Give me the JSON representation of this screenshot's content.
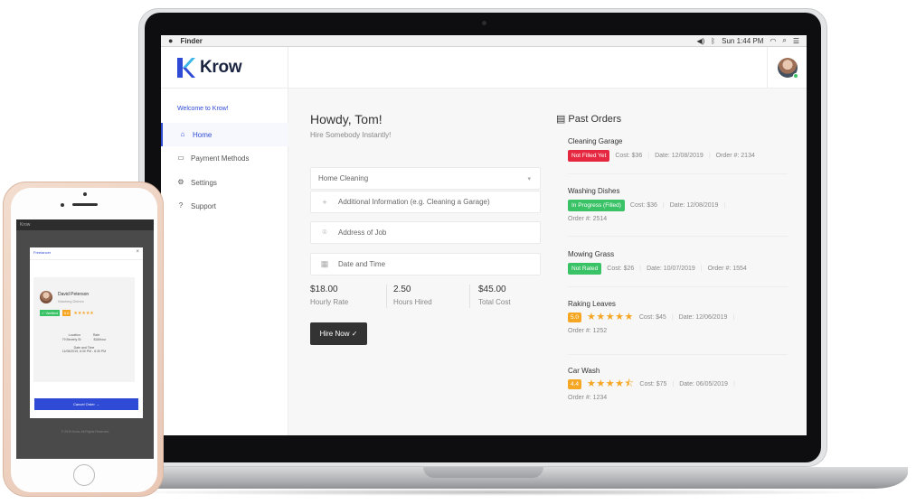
{
  "menubar": {
    "apple": "",
    "app": "Finder",
    "clock": "Sun 1:44 PM",
    "icons": [
      "volume-icon",
      "bluetooth-icon",
      "wifi-icon",
      "search-icon",
      "menu-icon"
    ]
  },
  "header": {
    "brand": "Krow",
    "brand_color": "#2f4bd6"
  },
  "sidebar": {
    "welcome": "Welcome to Krow!",
    "items": [
      {
        "label": "Home",
        "icon": "home-icon",
        "active": true
      },
      {
        "label": "Payment Methods",
        "icon": "credit-card-icon",
        "active": false
      },
      {
        "label": "Settings",
        "icon": "gear-icon",
        "active": false
      },
      {
        "label": "Support",
        "icon": "help-icon",
        "active": false
      }
    ]
  },
  "main": {
    "greeting": "Howdy, Tom!",
    "subtitle": "Hire Somebody Instantly!",
    "service_select": {
      "value": "Home Cleaning",
      "icon": "chevron-down-icon"
    },
    "fields": [
      {
        "placeholder": "Additional Information (e.g. Cleaning a Garage)",
        "icon": "plus-icon"
      },
      {
        "placeholder": "Address of Job",
        "icon": "map-pin-icon"
      },
      {
        "placeholder": "Date and Time",
        "icon": "calendar-icon"
      }
    ],
    "stats": [
      {
        "value": "$18.00",
        "label": "Hourly Rate"
      },
      {
        "value": "2.50",
        "label": "Hours Hired"
      },
      {
        "value": "$45.00",
        "label": "Total Cost"
      }
    ],
    "hire_button": "Hire Now ✓"
  },
  "past_orders": {
    "title": "Past Orders",
    "icon": "clipboard-icon",
    "orders": [
      {
        "name": "Cleaning Garage",
        "badge": "Not Filled Yet",
        "badge_color": "#e5283f",
        "cost": "Cost: $36",
        "date": "Date: 12/08/2019",
        "order": "Order #: 2134"
      },
      {
        "name": "Washing Dishes",
        "badge": "In Progress (Filled)",
        "badge_color": "#3ac266",
        "cost": "Cost: $36",
        "date": "Date: 12/08/2019",
        "order": "Order #: 2514"
      },
      {
        "name": "Mowing Grass",
        "badge": "Not Rated",
        "badge_color": "#3ac266",
        "cost": "Cost: $26",
        "date": "Date: 10/07/2019",
        "order": "Order #: 1554"
      },
      {
        "name": "Raking Leaves",
        "rating": "5.0",
        "stars": "★★★★★",
        "cost": "Cost: $45",
        "date": "Date: 12/06/2019",
        "order": "Order #: 1252"
      },
      {
        "name": "Car Wash",
        "rating": "4.4",
        "stars": "★★★★⯪",
        "cost": "Cost: $75",
        "date": "Date: 06/05/2019",
        "order": "Order #: 1234"
      }
    ]
  },
  "phone": {
    "bar_brand": "Krow",
    "tab": "Freelancer",
    "close": "×",
    "name": "David Peterson",
    "job": "Washing Dishes",
    "verified": "✓ Verified",
    "rating": "5.0",
    "stars": "★★★★★",
    "location_label": "Location",
    "location": "79 Beverly St",
    "rate_label": "Rate",
    "rate": "$18/hour",
    "datetime_label": "Date and Time",
    "datetime": "11/08/2019, 6:30 PM - 8:30 PM",
    "cancel_button": "Cancel Order →",
    "footer": "© 2019 Krow, All Rights Reserved"
  }
}
